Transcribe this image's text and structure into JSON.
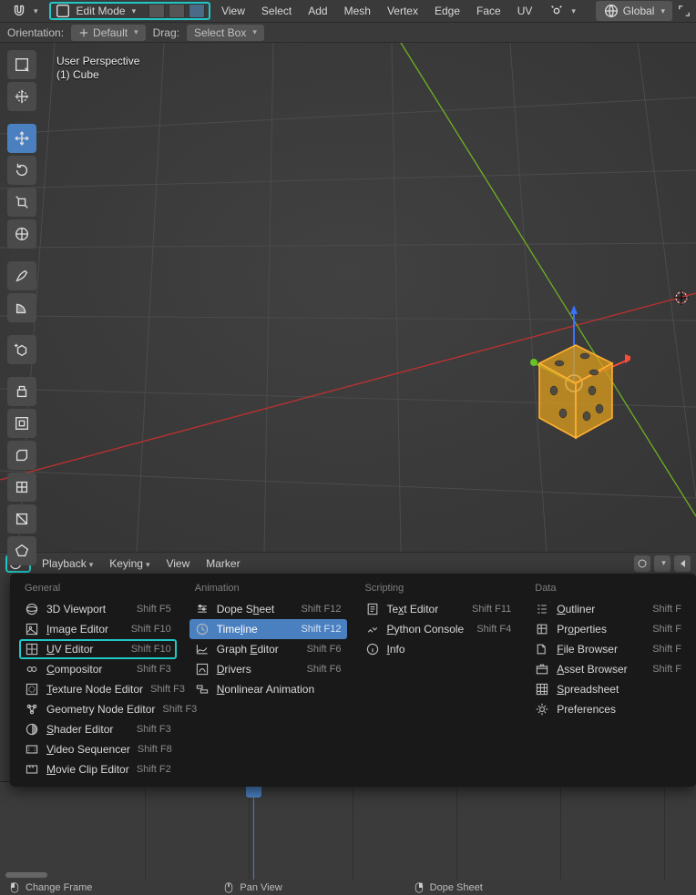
{
  "header": {
    "mode": "Edit Mode",
    "menus": [
      "View",
      "Select",
      "Add",
      "Mesh",
      "Vertex",
      "Edge",
      "Face",
      "UV"
    ],
    "global": "Global"
  },
  "secondbar": {
    "orientation_label": "Orientation:",
    "orientation_value": "Default",
    "drag_label": "Drag:",
    "drag_value": "Select Box"
  },
  "viewport": {
    "perspective": "User Perspective",
    "object": "(1) Cube"
  },
  "timeline_header": {
    "menus": [
      "Playback",
      "Keying",
      "View",
      "Marker"
    ]
  },
  "picker": {
    "columns": [
      {
        "title": "General",
        "items": [
          {
            "label": "3D Viewport",
            "shortcut": "Shift F5",
            "icon": "viewport"
          },
          {
            "label": "Image Editor",
            "shortcut": "Shift F10",
            "icon": "image",
            "ul": 0
          },
          {
            "label": "UV Editor",
            "shortcut": "Shift F10",
            "icon": "uv",
            "ul": 0,
            "boxed": true
          },
          {
            "label": "Compositor",
            "shortcut": "Shift F3",
            "icon": "comp",
            "ul": 0
          },
          {
            "label": "Texture Node Editor",
            "shortcut": "Shift F3",
            "icon": "tex",
            "ul": 0
          },
          {
            "label": "Geometry Node Editor",
            "shortcut": "Shift F3",
            "icon": "geo"
          },
          {
            "label": "Shader Editor",
            "shortcut": "Shift F3",
            "icon": "shader",
            "ul": 0
          },
          {
            "label": "Video Sequencer",
            "shortcut": "Shift F8",
            "icon": "video",
            "ul": 0
          },
          {
            "label": "Movie Clip Editor",
            "shortcut": "Shift F2",
            "icon": "clip",
            "ul": 0
          }
        ]
      },
      {
        "title": "Animation",
        "items": [
          {
            "label": "Dope Sheet",
            "shortcut": "Shift F12",
            "icon": "dope",
            "ul": 6
          },
          {
            "label": "Timeline",
            "shortcut": "Shift F12",
            "icon": "timeline",
            "ul": 4,
            "highlight": true
          },
          {
            "label": "Graph Editor",
            "shortcut": "Shift F6",
            "icon": "graph",
            "ul": 6
          },
          {
            "label": "Drivers",
            "shortcut": "Shift F6",
            "icon": "drivers",
            "ul": 0
          },
          {
            "label": "Nonlinear Animation",
            "shortcut": "",
            "icon": "nla",
            "ul": 0
          }
        ]
      },
      {
        "title": "Scripting",
        "items": [
          {
            "label": "Text Editor",
            "shortcut": "Shift F11",
            "icon": "text",
            "ul": 2
          },
          {
            "label": "Python Console",
            "shortcut": "Shift F4",
            "icon": "py",
            "ul": 0
          },
          {
            "label": "Info",
            "shortcut": "",
            "icon": "info",
            "ul": 0
          }
        ]
      },
      {
        "title": "Data",
        "items": [
          {
            "label": "Outliner",
            "shortcut": "Shift F",
            "icon": "outliner",
            "ul": 0
          },
          {
            "label": "Properties",
            "shortcut": "Shift F",
            "icon": "props",
            "ul": 2
          },
          {
            "label": "File Browser",
            "shortcut": "Shift F",
            "icon": "file",
            "ul": 0
          },
          {
            "label": "Asset Browser",
            "shortcut": "Shift F",
            "icon": "asset",
            "ul": 0
          },
          {
            "label": "Spreadsheet",
            "shortcut": "",
            "icon": "spread",
            "ul": 0
          },
          {
            "label": "Preferences",
            "shortcut": "",
            "icon": "prefs"
          }
        ]
      }
    ]
  },
  "footer": {
    "items": [
      "Change Frame",
      "Pan View",
      "Dope Sheet"
    ]
  }
}
